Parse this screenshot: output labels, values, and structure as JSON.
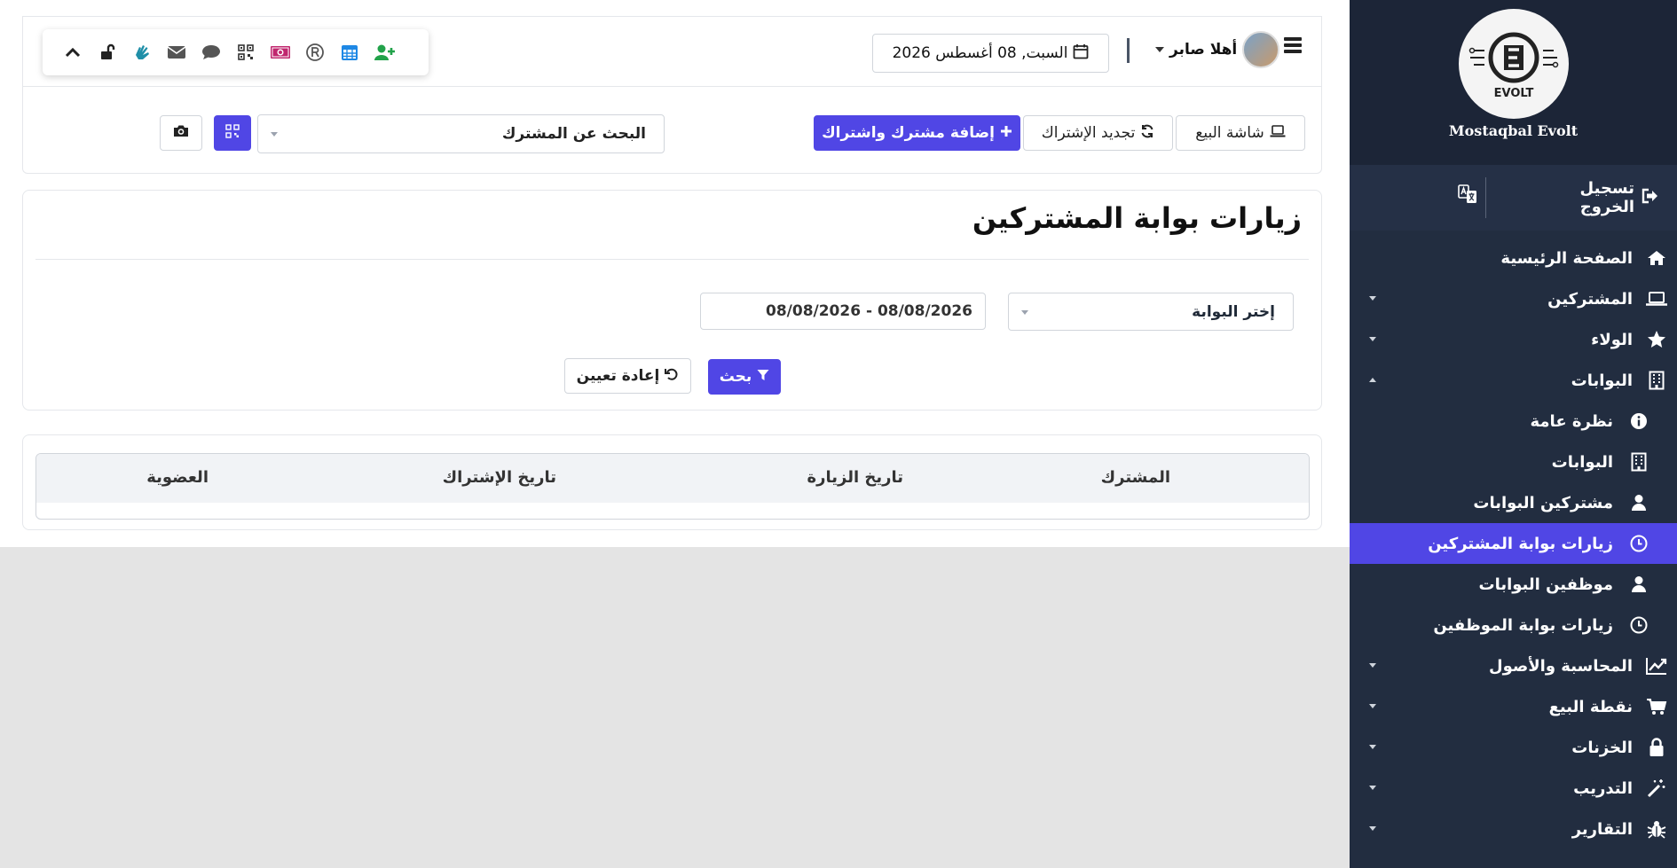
{
  "sidebar": {
    "brand_name": "Mostaqbal Evolt",
    "logo_text": "EVOLT",
    "logout_label": "تسجيل الخروج",
    "items": [
      {
        "label": "الصفحة الرئيسية",
        "icon": "home-icon"
      },
      {
        "label": "المشتركين",
        "icon": "laptop-icon"
      },
      {
        "label": "الولاء",
        "icon": "star-icon"
      },
      {
        "label": "البوابات",
        "icon": "building-icon"
      }
    ],
    "sub_items": [
      {
        "label": "نظرة عامة",
        "icon": "info-icon"
      },
      {
        "label": "البوابات",
        "icon": "building-icon"
      },
      {
        "label": "مشتركين البوابات",
        "icon": "user-icon"
      },
      {
        "label": "زيارات بوابة المشتركين",
        "icon": "clock-icon",
        "active": true
      },
      {
        "label": "موظفين البوابات",
        "icon": "user-icon"
      },
      {
        "label": "زيارات بوابة الموظفين",
        "icon": "clock-icon"
      }
    ],
    "items_after": [
      {
        "label": "المحاسبة والأصول",
        "icon": "chart-line-icon"
      },
      {
        "label": "نقطة البيع",
        "icon": "cart-icon"
      },
      {
        "label": "الخزنات",
        "icon": "lock-icon"
      },
      {
        "label": "التدريب",
        "icon": "magic-wand-icon"
      },
      {
        "label": "التقارير",
        "icon": "bug-icon"
      }
    ]
  },
  "header": {
    "date": "السبت, 08 أغسطس 2026",
    "greeting": "أهلا صابر"
  },
  "actions": {
    "pos_label": "شاشة البيع",
    "renew_label": "تجديد الإشتراك",
    "add_label": "إضافة مشترك واشتراك",
    "search_placeholder": "البحث عن المشترك"
  },
  "filters": {
    "page_title": "زيارات بوابة المشتركين",
    "gate_placeholder": "إختر البوابة",
    "date_range": "08/08/2026 - 08/08/2026",
    "search_label": "بحث",
    "reset_label": "إعادة تعيين"
  },
  "table": {
    "columns": [
      "المشترك",
      "تاريخ الزيارة",
      "تاريخ الإشتراك",
      "العضوية"
    ]
  },
  "colors": {
    "primary": "#5046e5",
    "sidebar": "#222d40",
    "sidebar_header": "#1c2537"
  }
}
